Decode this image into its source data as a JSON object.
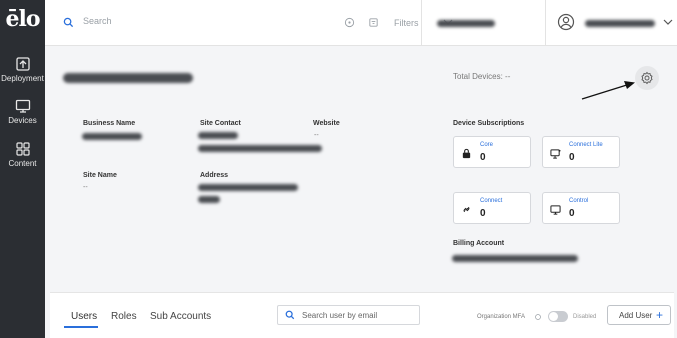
{
  "app": {
    "logo": "ēlo"
  },
  "sidebar": {
    "items": [
      {
        "label": "Deployment",
        "icon": "upload-box-icon"
      },
      {
        "label": "Devices",
        "icon": "monitor-icon"
      },
      {
        "label": "Content",
        "icon": "grid-icon"
      }
    ]
  },
  "header": {
    "search_placeholder": "Search",
    "filters_label": "Filters"
  },
  "account": {
    "total_devices_label": "Total Devices:",
    "total_devices_value": "--",
    "fields": {
      "business_name_label": "Business Name",
      "site_contact_label": "Site Contact",
      "website_label": "Website",
      "website_value": "--",
      "site_name_label": "Site Name",
      "site_name_value": "--",
      "address_label": "Address"
    },
    "subscriptions_label": "Device Subscriptions",
    "subscriptions": [
      {
        "name": "Core",
        "count": "0",
        "icon": "lock-icon"
      },
      {
        "name": "Connect Lite",
        "count": "0",
        "icon": "monitor-cast-icon"
      },
      {
        "name": "Connect",
        "count": "0",
        "icon": "link-icon"
      },
      {
        "name": "Control",
        "count": "0",
        "icon": "monitor-icon"
      }
    ],
    "billing_label": "Billing Account"
  },
  "bottom": {
    "tabs": [
      {
        "label": "Users",
        "active": true
      },
      {
        "label": "Roles",
        "active": false
      },
      {
        "label": "Sub Accounts",
        "active": false
      }
    ],
    "user_search_placeholder": "Search user by email",
    "mfa_label": "Organization MFA",
    "mfa_state_label": "Disabled",
    "add_user_label": "Add User"
  },
  "colors": {
    "accent": "#2a6fdb",
    "sidebar_bg": "#2b2e33"
  }
}
